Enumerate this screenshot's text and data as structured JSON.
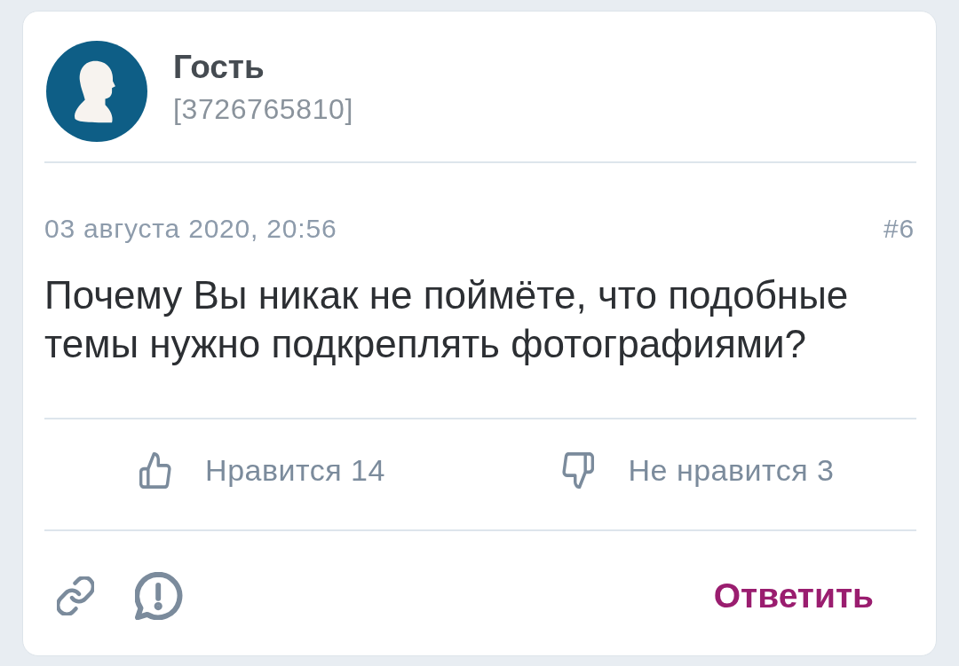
{
  "author": {
    "name": "Гость",
    "id": "[3726765810]"
  },
  "post": {
    "date": "03 августа 2020, 20:56",
    "number": "#6",
    "text": "Почему Вы никак не поймёте, что подобные темы нужно подкреплять фотографиями?"
  },
  "votes": [
    {
      "kind": "like",
      "label": "Нравится 14"
    },
    {
      "kind": "dislike",
      "label": "Не нравится 3"
    }
  ],
  "actions": {
    "reply": "Ответить"
  }
}
